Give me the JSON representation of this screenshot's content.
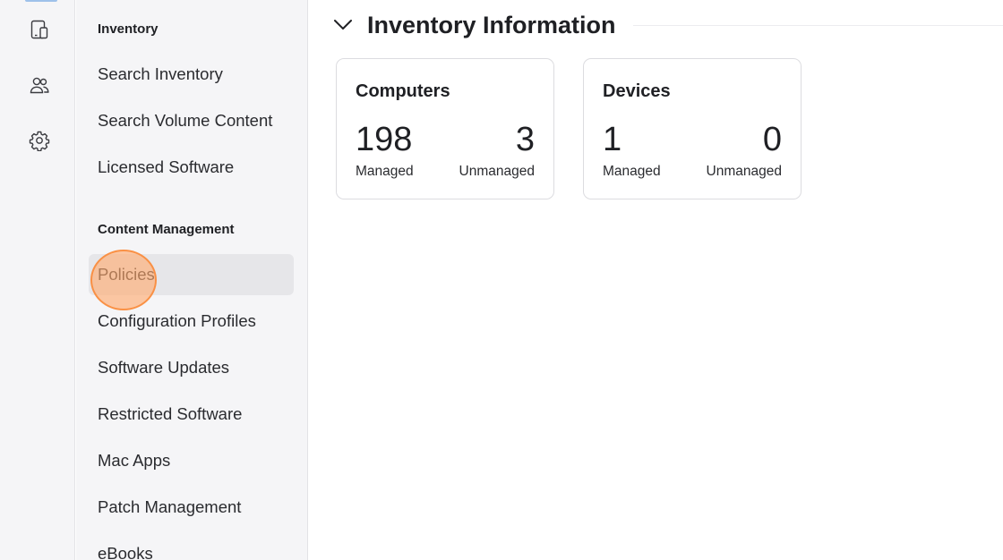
{
  "rail": {
    "icons": [
      "mobile-device-icon",
      "users-icon",
      "settings-gear-icon"
    ],
    "active_color": "#9ec1ea"
  },
  "nav": {
    "sections": [
      {
        "heading": "Inventory",
        "items": [
          "Search Inventory",
          "Search Volume Content",
          "Licensed Software"
        ]
      },
      {
        "heading": "Content Management",
        "items": [
          "Policies",
          "Configuration Profiles",
          "Software Updates",
          "Restricted Software",
          "Mac Apps",
          "Patch Management",
          "eBooks"
        ]
      }
    ],
    "selected": "Policies"
  },
  "main": {
    "section_title": "Inventory Information",
    "cards": [
      {
        "title": "Computers",
        "managed_count": "198",
        "managed_label": "Managed",
        "unmanaged_count": "3",
        "unmanaged_label": "Unmanaged"
      },
      {
        "title": "Devices",
        "managed_count": "1",
        "managed_label": "Managed",
        "unmanaged_count": "0",
        "unmanaged_label": "Unmanaged"
      }
    ]
  },
  "colors": {
    "sidebar_bg": "#f5f5f7",
    "selected_item_bg": "#e6e6e9",
    "click_marker": "#ffaa6e"
  }
}
